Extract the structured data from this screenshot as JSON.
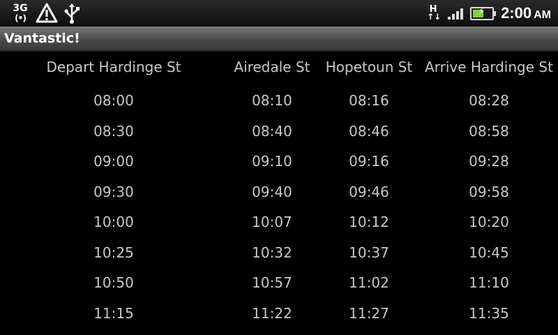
{
  "status_bar": {
    "network_type": "3G",
    "data_type": "H",
    "time": "2:00",
    "ampm": "AM",
    "battery_level": 0.6,
    "icons": [
      "signal-3g-icon",
      "warning-icon",
      "usb-icon",
      "hspa-data-icon",
      "signal-bars-icon",
      "battery-charging-icon"
    ]
  },
  "app": {
    "title": "Vantastic!"
  },
  "timetable": {
    "columns": [
      "Depart Hardinge St",
      "Airedale St",
      "Hopetoun St",
      "Arrive Hardinge St"
    ],
    "rows": [
      [
        "08:00",
        "08:10",
        "08:16",
        "08:28"
      ],
      [
        "08:30",
        "08:40",
        "08:46",
        "08:58"
      ],
      [
        "09:00",
        "09:10",
        "09:16",
        "09:28"
      ],
      [
        "09:30",
        "09:40",
        "09:46",
        "09:58"
      ],
      [
        "10:00",
        "10:07",
        "10:12",
        "10:20"
      ],
      [
        "10:25",
        "10:32",
        "10:37",
        "10:45"
      ],
      [
        "10:50",
        "10:57",
        "11:02",
        "11:10"
      ],
      [
        "11:15",
        "11:22",
        "11:27",
        "11:35"
      ]
    ]
  },
  "colors": {
    "background": "#000000",
    "text": "#c8c8c8",
    "battery_fill": "#7ed13b"
  }
}
